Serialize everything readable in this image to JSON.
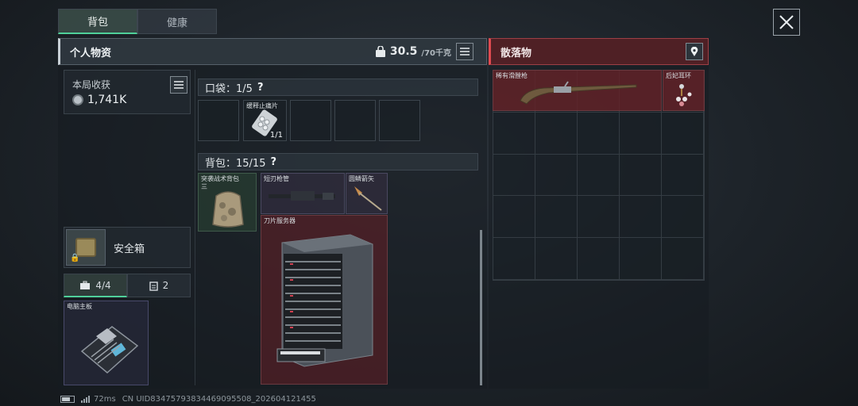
{
  "tabs": {
    "backpack": "背包",
    "health": "健康"
  },
  "personal": {
    "title": "个人物资",
    "weight": "30.5",
    "weight_max": "/70千克"
  },
  "gains": {
    "title": "本局收获",
    "value": "1,741K"
  },
  "pocket": {
    "label": "口袋：1/5",
    "help": "?",
    "slots": [
      {
        "name": "",
        "count": ""
      },
      {
        "name": "缓释止痛片",
        "count": "1/1"
      },
      {
        "name": "",
        "count": ""
      },
      {
        "name": "",
        "count": ""
      },
      {
        "name": "",
        "count": ""
      }
    ]
  },
  "bag": {
    "label": "背包：15/15",
    "help": "?"
  },
  "items": {
    "assault_pack": "突袭战术背包",
    "assault_pack_tag": "三",
    "barrel": "短刃枪管",
    "arrow": "圆鳞箭矢",
    "server": "刀片服务器"
  },
  "safebox": {
    "label": "安全箱"
  },
  "subtabs": {
    "tools": "4/4",
    "cards": "2"
  },
  "motherboard": {
    "label": "电脑主板"
  },
  "scatter": {
    "title": "散落物",
    "item1": "稀有滑膛枪",
    "item2": "后妃耳环"
  },
  "footer": {
    "ping": "72ms",
    "uid": "CN UID83475793834469095508_202604121455"
  },
  "colors": {
    "accent": "#4fd09a",
    "rare_red": "#6a3a40",
    "scatter_red": "#9d3f45"
  }
}
